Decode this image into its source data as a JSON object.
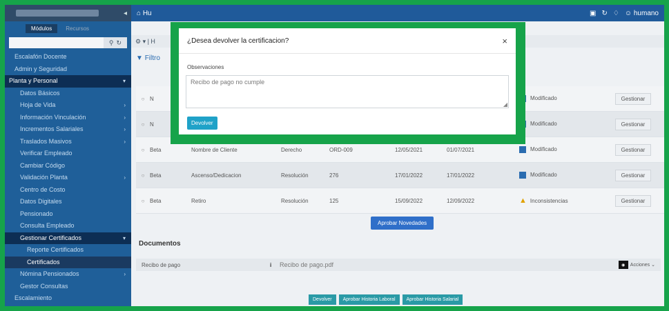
{
  "sidebar": {
    "tabs": [
      "Módulos",
      "Recursos"
    ],
    "items": [
      {
        "label": "Escalafón Docente",
        "level": 1
      },
      {
        "label": "Admin y Seguridad",
        "level": 1
      },
      {
        "label": "Planta y Personal",
        "level": 0,
        "expanded": true
      },
      {
        "label": "Datos Básicos",
        "level": 2
      },
      {
        "label": "Hoja de Vida",
        "level": 2,
        "chevron": true
      },
      {
        "label": "Información Vinculación",
        "level": 2,
        "chevron": true
      },
      {
        "label": "Incrementos Salariales",
        "level": 2,
        "chevron": true
      },
      {
        "label": "Traslados Masivos",
        "level": 2,
        "chevron": true
      },
      {
        "label": "Verificar Empleado",
        "level": 2
      },
      {
        "label": "Cambiar Código",
        "level": 2
      },
      {
        "label": "Validación Planta",
        "level": 2,
        "chevron": true
      },
      {
        "label": "Centro de Costo",
        "level": 2
      },
      {
        "label": "Datos Digitales",
        "level": 2
      },
      {
        "label": "Pensionado",
        "level": 2
      },
      {
        "label": "Consulta Empleado",
        "level": 2
      },
      {
        "label": "Gestionar Certificados",
        "level": 2,
        "expanded": true,
        "dark": true
      },
      {
        "label": "Reporte Certificados",
        "level": 3
      },
      {
        "label": "Certificados",
        "level": 3,
        "active": true
      },
      {
        "label": "Nómina Pensionados",
        "level": 2,
        "chevron": true
      },
      {
        "label": "Gestor Consultas",
        "level": 2
      },
      {
        "label": "Escalamiento",
        "level": 1
      }
    ]
  },
  "topbar": {
    "brand": "Hu",
    "user": "humano"
  },
  "toolbar": {
    "text": "⚙ ▾ | H"
  },
  "filter_label": "Filtro",
  "table": {
    "rows": [
      {
        "c1": "N",
        "c2": "",
        "c3": "",
        "c4": "",
        "c5": "",
        "c6": "",
        "status": "Modificado",
        "status_icon": "edit-icon",
        "action": "Gestionar"
      },
      {
        "c1": "N",
        "c2": "",
        "c3": "",
        "c4": "",
        "c5": "",
        "c6": "",
        "status": "Modificado",
        "status_icon": "edit-icon",
        "action": "Gestionar"
      },
      {
        "c1": "Beta",
        "c2": "Nombre de Cliente",
        "c3": "Derecho",
        "c4": "ORD-009",
        "c5": "12/05/2021",
        "c6": "01/07/2021",
        "status": "Modificado",
        "status_icon": "edit-icon",
        "action": "Gestionar"
      },
      {
        "c1": "Beta",
        "c2": "Ascenso/Dedicacion",
        "c3": "Resolución",
        "c4": "276",
        "c5": "17/01/2022",
        "c6": "17/01/2022",
        "status": "Modificado",
        "status_icon": "edit-icon",
        "action": "Gestionar"
      },
      {
        "c1": "Beta",
        "c2": "Retiro",
        "c3": "Resolución",
        "c4": "125",
        "c5": "15/09/2022",
        "c6": "12/09/2022",
        "status": "Inconsistencias",
        "status_icon": "warning-icon",
        "action": "Gestionar"
      }
    ]
  },
  "approve_button": "Aprobar Novedades",
  "documents": {
    "title": "Documentos",
    "row": {
      "name": "Recibo de pago",
      "file": "Recibo de pago.pdf",
      "select": "Acciones"
    }
  },
  "actions": [
    "Devolver",
    "Aprobar Historia Laboral",
    "Aprobar Historia Salarial"
  ],
  "modal": {
    "title": "¿Desea devolver la certificacion?",
    "close": "×",
    "label": "Observaciones",
    "value": "Recibo de pago no cumple",
    "button": "Devolver"
  }
}
